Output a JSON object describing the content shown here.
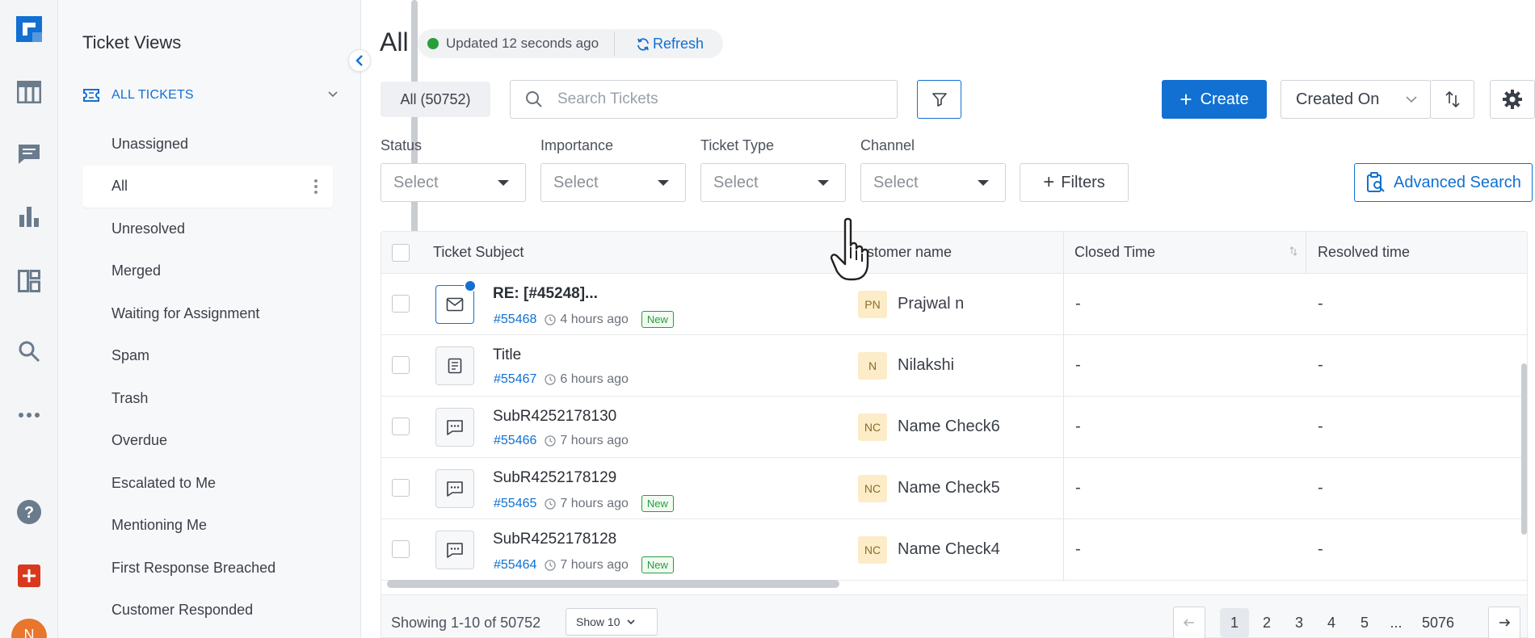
{
  "rail": {
    "icons": [
      "logo-icon",
      "tickets-table-icon",
      "chat-icon",
      "analytics-icon",
      "dashboard-icon",
      "search-icon",
      "more-icon",
      "help-icon",
      "add-icon"
    ],
    "avatar_initial": "N"
  },
  "views": {
    "title": "Ticket Views",
    "group_label": "ALL TICKETS",
    "items": [
      {
        "label": "Unassigned"
      },
      {
        "label": "All"
      },
      {
        "label": "Unresolved"
      },
      {
        "label": "Merged"
      },
      {
        "label": "Waiting for Assignment"
      },
      {
        "label": "Spam"
      },
      {
        "label": "Trash"
      },
      {
        "label": "Overdue"
      },
      {
        "label": "Escalated to Me"
      },
      {
        "label": "Mentioning Me"
      },
      {
        "label": "First Response Breached"
      },
      {
        "label": "Customer Responded"
      }
    ],
    "active_index": 1
  },
  "header": {
    "title": "All",
    "updated_text": "Updated 12 seconds ago",
    "refresh_label": "Refresh"
  },
  "toolbar": {
    "count_label": "All (50752)",
    "search_placeholder": "Search Tickets",
    "create_label": "Create",
    "sort_label": "Created On"
  },
  "filters": {
    "groups": [
      {
        "label": "Status",
        "value": "Select"
      },
      {
        "label": "Importance",
        "value": "Select"
      },
      {
        "label": "Ticket Type",
        "value": "Select"
      },
      {
        "label": "Channel",
        "value": "Select"
      }
    ],
    "filters_label": "Filters",
    "advanced_search_label": "Advanced Search"
  },
  "table": {
    "columns": [
      "Ticket Subject",
      "stomer name",
      "Closed Time",
      "Resolved time"
    ],
    "rows": [
      {
        "subject": "RE: [#45248]...",
        "number": "#55468",
        "time": "4 hours ago",
        "badge": "New",
        "icon": "email-icon",
        "unread": true,
        "initials": "PN",
        "customer": "Prajwal n",
        "closed": "-",
        "resolved": "-"
      },
      {
        "subject": "Title",
        "number": "#55467",
        "time": "6 hours ago",
        "badge": "",
        "icon": "form-icon",
        "unread": false,
        "initials": "N",
        "customer": "Nilakshi",
        "closed": "-",
        "resolved": "-"
      },
      {
        "subject": "SubR4252178130",
        "number": "#55466",
        "time": "7 hours ago",
        "badge": "",
        "icon": "chat-bubble-icon",
        "unread": false,
        "initials": "NC",
        "customer": "Name Check6",
        "closed": "-",
        "resolved": "-"
      },
      {
        "subject": "SubR4252178129",
        "number": "#55465",
        "time": "7 hours ago",
        "badge": "New",
        "icon": "chat-bubble-icon",
        "unread": false,
        "initials": "NC",
        "customer": "Name Check5",
        "closed": "-",
        "resolved": "-"
      },
      {
        "subject": "SubR4252178128",
        "number": "#55464",
        "time": "7 hours ago",
        "badge": "New",
        "icon": "chat-bubble-icon",
        "unread": false,
        "initials": "NC",
        "customer": "Name Check4",
        "closed": "-",
        "resolved": "-"
      }
    ]
  },
  "footer": {
    "showing": "Showing 1-10 of 50752",
    "page_size": "Show 10",
    "pages": [
      "1",
      "2",
      "3",
      "4",
      "5",
      "...",
      "5076"
    ],
    "active_page": "1"
  },
  "colors": {
    "accent": "#1170d2",
    "success": "#2a9d3b",
    "add_button": "#d9381e",
    "avatar": "#e8762d"
  }
}
